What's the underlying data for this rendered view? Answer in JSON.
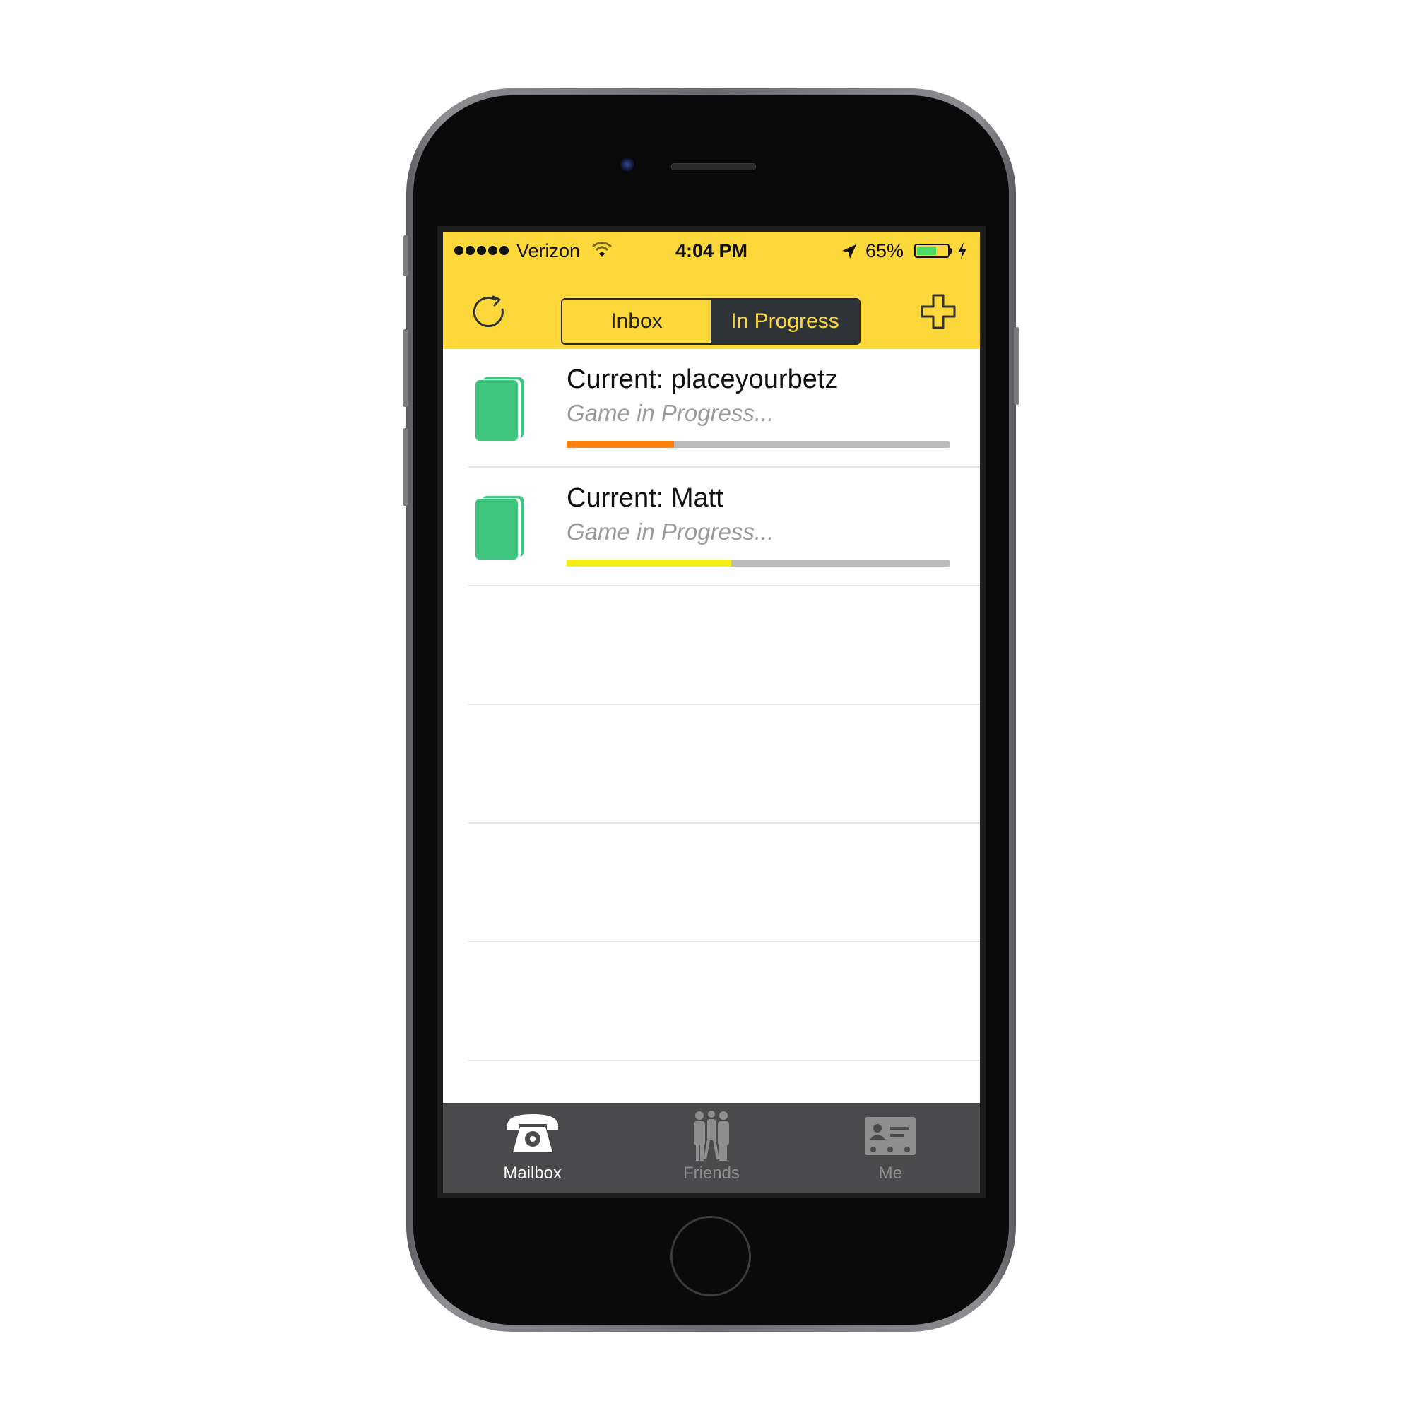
{
  "status_bar": {
    "carrier": "Verizon",
    "time": "4:04 PM",
    "battery_percent": "65%",
    "battery_level": 0.65,
    "signal_bars": 5
  },
  "nav": {
    "segments": [
      {
        "label": "Inbox",
        "selected": false
      },
      {
        "label": "In Progress",
        "selected": true
      }
    ],
    "refresh_icon": "refresh-icon",
    "add_icon": "plus-icon"
  },
  "games": [
    {
      "title": "Current: placeyourbetz",
      "subtitle": "Game in Progress...",
      "progress": 0.28,
      "progress_color": "#ff7f0f",
      "icon": "cards-icon"
    },
    {
      "title": "Current: Matt",
      "subtitle": "Game in Progress...",
      "progress": 0.43,
      "progress_color": "#f5ee16",
      "icon": "cards-icon"
    }
  ],
  "empty_rows": 4,
  "tabs": [
    {
      "label": "Mailbox",
      "icon": "telephone-icon",
      "active": true
    },
    {
      "label": "Friends",
      "icon": "friends-icon",
      "active": false
    },
    {
      "label": "Me",
      "icon": "id-card-icon",
      "active": false
    }
  ],
  "colors": {
    "accent_yellow": "#fdd83a",
    "segment_dark": "#2e3338",
    "card_green": "#3ec67e",
    "tab_bar": "#4a4a4c"
  }
}
